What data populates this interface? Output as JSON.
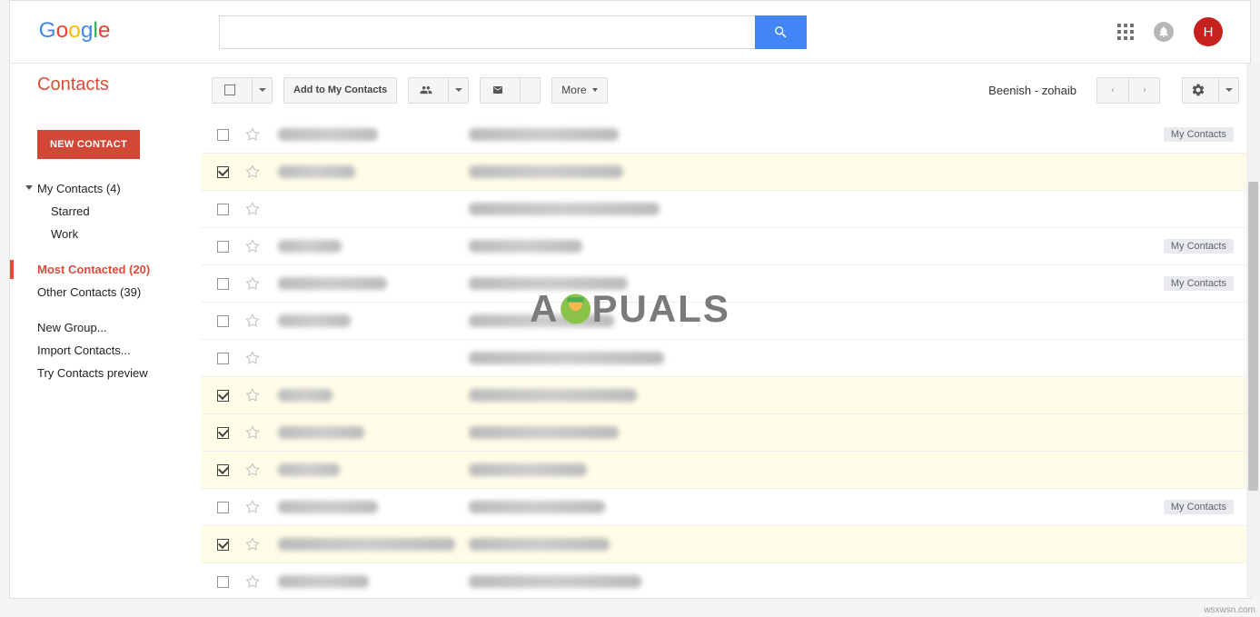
{
  "header": {
    "search_placeholder": "",
    "avatar_letter": "H"
  },
  "sidebar": {
    "app_title": "Contacts",
    "new_contact_label": "NEW CONTACT",
    "my_contacts_label": "My Contacts (4)",
    "starred_label": "Starred",
    "work_label": "Work",
    "most_contacted_label": "Most Contacted (20)",
    "other_contacts_label": "Other Contacts (39)",
    "new_group_label": "New Group...",
    "import_contacts_label": "Import Contacts...",
    "try_preview_label": "Try Contacts preview"
  },
  "toolbar": {
    "add_to_contacts_label": "Add to My Contacts",
    "more_label": "More",
    "account_name": "Beenish - zohaib"
  },
  "labels": {
    "my_contacts_chip": "My Contacts"
  },
  "contacts": [
    {
      "selected": false,
      "name_w": 110,
      "email_w": 165,
      "label": "My Contacts"
    },
    {
      "selected": true,
      "name_w": 85,
      "email_w": 170,
      "label": null
    },
    {
      "selected": false,
      "name_w": 0,
      "email_w": 210,
      "label": null
    },
    {
      "selected": false,
      "name_w": 70,
      "email_w": 125,
      "label": "My Contacts"
    },
    {
      "selected": false,
      "name_w": 120,
      "email_w": 175,
      "label": "My Contacts"
    },
    {
      "selected": false,
      "name_w": 80,
      "email_w": 160,
      "label": null
    },
    {
      "selected": false,
      "name_w": 0,
      "email_w": 215,
      "label": null
    },
    {
      "selected": true,
      "name_w": 60,
      "email_w": 185,
      "label": null
    },
    {
      "selected": true,
      "name_w": 95,
      "email_w": 165,
      "label": null
    },
    {
      "selected": true,
      "name_w": 68,
      "email_w": 130,
      "label": null
    },
    {
      "selected": false,
      "name_w": 110,
      "email_w": 150,
      "label": "My Contacts"
    },
    {
      "selected": true,
      "name_w": 195,
      "email_w": 155,
      "label": null
    },
    {
      "selected": false,
      "name_w": 100,
      "email_w": 190,
      "label": null
    }
  ],
  "watermark": {
    "left": "A",
    "right": "PUALS"
  },
  "footer_source": "wsxwsn.com"
}
